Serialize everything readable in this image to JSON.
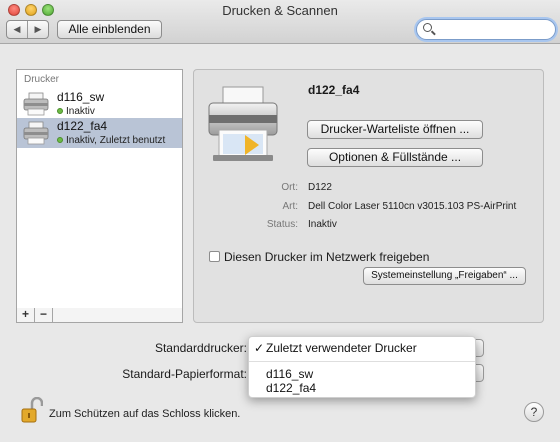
{
  "window": {
    "title": "Drucken & Scannen",
    "show_all_label": "Alle einblenden",
    "nav_back": "◀",
    "nav_forward": "▶",
    "search_placeholder": ""
  },
  "printer_list": {
    "header": "Drucker",
    "items": [
      {
        "name": "d116_sw",
        "status": "Inaktiv",
        "selected": false
      },
      {
        "name": "d122_fa4",
        "status": "Inaktiv, Zuletzt benutzt",
        "selected": true
      }
    ],
    "add_label": "+",
    "remove_label": "−"
  },
  "detail": {
    "printer_name": "d122_fa4",
    "queue_button": "Drucker-Warteliste öffnen ...",
    "options_button": "Optionen & Füllstände ...",
    "rows": [
      {
        "label": "Ort:",
        "value": "D122"
      },
      {
        "label": "Art:",
        "value": "Dell Color Laser 5110cn v3015.103 PS-AirPrint"
      },
      {
        "label": "Status:",
        "value": "Inaktiv"
      }
    ],
    "share_label": "Diesen Drucker im Netzwerk freigeben",
    "share_checked": false,
    "sharing_prefs_button": "Systemeinstellung „Freigaben“ ..."
  },
  "bottom": {
    "default_printer_label": "Standarddrucker:",
    "paper_format_label": "Standard-Papierformat:",
    "menu": {
      "checked_item": "Zuletzt verwendeter Drucker",
      "check_mark": "✓",
      "items": [
        "d116_sw",
        "d122_fa4"
      ]
    },
    "lock_text": "Zum Schützen auf das Schloss klicken.",
    "help_label": "?"
  },
  "colors": {
    "selection": "#b9c4d6",
    "status_dot": "#6dbb45"
  }
}
